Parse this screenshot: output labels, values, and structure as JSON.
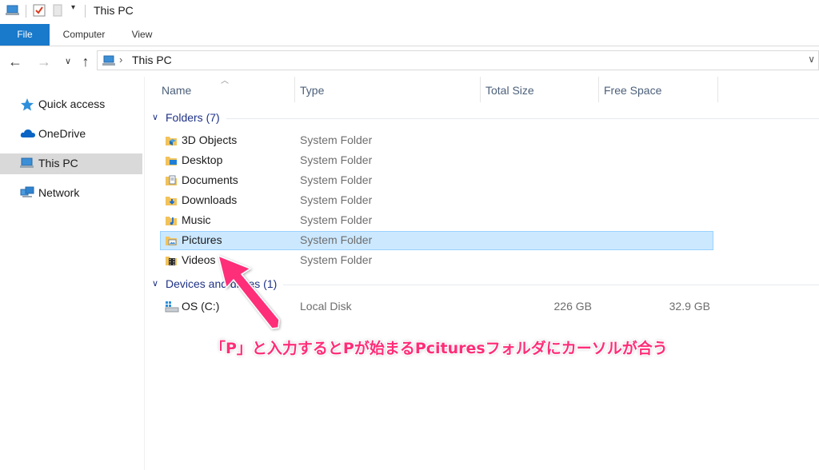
{
  "window": {
    "title": "This PC"
  },
  "ribbon": {
    "tabs": [
      "File",
      "Computer",
      "View"
    ]
  },
  "address": {
    "crumb": "This PC"
  },
  "nav_pane": {
    "items": [
      {
        "label": "Quick access",
        "icon": "star-icon"
      },
      {
        "label": "OneDrive",
        "icon": "cloud-icon"
      },
      {
        "label": "This PC",
        "icon": "computer-icon",
        "selected": true
      },
      {
        "label": "Network",
        "icon": "network-icon"
      }
    ]
  },
  "columns": {
    "name": "Name",
    "type": "Type",
    "total": "Total Size",
    "free": "Free Space"
  },
  "groups": {
    "folders": {
      "label": "Folders (7)",
      "items": [
        {
          "name": "3D Objects",
          "type": "System Folder"
        },
        {
          "name": "Desktop",
          "type": "System Folder"
        },
        {
          "name": "Documents",
          "type": "System Folder"
        },
        {
          "name": "Downloads",
          "type": "System Folder"
        },
        {
          "name": "Music",
          "type": "System Folder"
        },
        {
          "name": "Pictures",
          "type": "System Folder",
          "selected": true
        },
        {
          "name": "Videos",
          "type": "System Folder"
        }
      ]
    },
    "drives": {
      "label": "Devices and drives (1)",
      "items": [
        {
          "name": "OS (C:)",
          "type": "Local Disk",
          "total": "226 GB",
          "free": "32.9 GB"
        }
      ]
    }
  },
  "annotation": {
    "text": "「P」と入力するとPが始まるPcituresフォルダにカーソルが合う",
    "color": "#ff2d78"
  },
  "colors": {
    "accent": "#1979ca",
    "selection": "#cce8ff",
    "selection_border": "#99d1ff",
    "group_header": "#1e3287"
  }
}
